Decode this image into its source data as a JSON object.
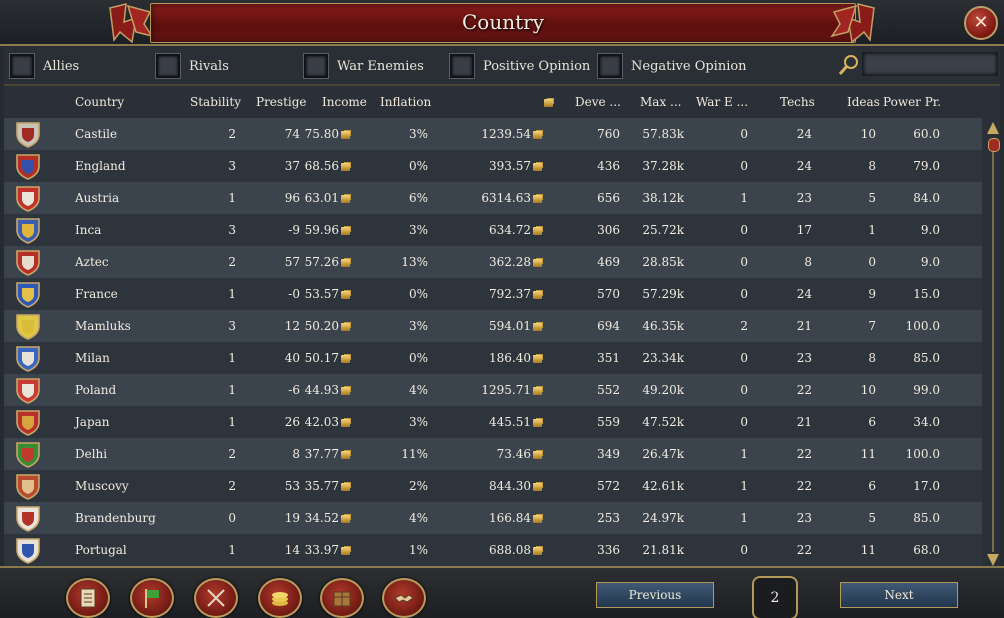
{
  "window": {
    "title": "Country",
    "close_icon": "close-icon"
  },
  "filters": [
    {
      "label": "Allies",
      "checked": false
    },
    {
      "label": "Rivals",
      "checked": false
    },
    {
      "label": "War Enemies",
      "checked": false
    },
    {
      "label": "Positive Opinion",
      "checked": false
    },
    {
      "label": "Negative Opinion",
      "checked": false
    }
  ],
  "search": {
    "value": "",
    "icon": "magnifier-icon"
  },
  "columns": [
    "Country",
    "Stability",
    "Prestige",
    "Income",
    "Inflation",
    "",
    "Deve ...",
    "Max  ...",
    "War E ...",
    "Techs",
    "Ideas",
    "Power Pr."
  ],
  "rows": [
    {
      "country": "Castile",
      "stability": "2",
      "prestige": "74",
      "income": "75.80",
      "inflation": "3%",
      "treasury": "1239.54",
      "development": "760",
      "max": "57.83k",
      "war": "0",
      "techs": "24",
      "ideas": "10",
      "power": "60.0",
      "colors": [
        "#c9c4b8",
        "#a22a24"
      ]
    },
    {
      "country": "England",
      "stability": "3",
      "prestige": "37",
      "income": "68.56",
      "inflation": "0%",
      "treasury": "393.57",
      "development": "436",
      "max": "37.28k",
      "war": "0",
      "techs": "24",
      "ideas": "8",
      "power": "79.0",
      "colors": [
        "#b03026",
        "#3550a8"
      ]
    },
    {
      "country": "Austria",
      "stability": "1",
      "prestige": "96",
      "income": "63.01",
      "inflation": "6%",
      "treasury": "6314.63",
      "development": "656",
      "max": "38.12k",
      "war": "1",
      "techs": "23",
      "ideas": "5",
      "power": "84.0",
      "colors": [
        "#c2322a",
        "#e9e5dc"
      ]
    },
    {
      "country": "Inca",
      "stability": "3",
      "prestige": "-9",
      "income": "59.96",
      "inflation": "3%",
      "treasury": "634.72",
      "development": "306",
      "max": "25.72k",
      "war": "0",
      "techs": "17",
      "ideas": "1",
      "power": "9.0",
      "colors": [
        "#3b5fb0",
        "#e0b53c"
      ]
    },
    {
      "country": "Aztec",
      "stability": "2",
      "prestige": "57",
      "income": "57.26",
      "inflation": "13%",
      "treasury": "362.28",
      "development": "469",
      "max": "28.85k",
      "war": "0",
      "techs": "8",
      "ideas": "0",
      "power": "9.0",
      "colors": [
        "#b62e28",
        "#e6dccb"
      ]
    },
    {
      "country": "France",
      "stability": "1",
      "prestige": "-0",
      "income": "53.57",
      "inflation": "0%",
      "treasury": "792.37",
      "development": "570",
      "max": "57.29k",
      "war": "0",
      "techs": "24",
      "ideas": "9",
      "power": "15.0",
      "colors": [
        "#2d58b8",
        "#e3c04a"
      ]
    },
    {
      "country": "Mamluks",
      "stability": "3",
      "prestige": "12",
      "income": "50.20",
      "inflation": "3%",
      "treasury": "594.01",
      "development": "694",
      "max": "46.35k",
      "war": "2",
      "techs": "21",
      "ideas": "7",
      "power": "100.0",
      "colors": [
        "#e0c744",
        "#d8bc38"
      ]
    },
    {
      "country": "Milan",
      "stability": "1",
      "prestige": "40",
      "income": "50.17",
      "inflation": "0%",
      "treasury": "186.40",
      "development": "351",
      "max": "23.34k",
      "war": "0",
      "techs": "23",
      "ideas": "8",
      "power": "85.0",
      "colors": [
        "#3a66c0",
        "#e8e2d6"
      ]
    },
    {
      "country": "Poland",
      "stability": "1",
      "prestige": "-6",
      "income": "44.93",
      "inflation": "4%",
      "treasury": "1295.71",
      "development": "552",
      "max": "49.20k",
      "war": "0",
      "techs": "22",
      "ideas": "10",
      "power": "99.0",
      "colors": [
        "#c93b34",
        "#ebe6dc"
      ]
    },
    {
      "country": "Japan",
      "stability": "1",
      "prestige": "26",
      "income": "42.03",
      "inflation": "3%",
      "treasury": "445.51",
      "development": "559",
      "max": "47.52k",
      "war": "0",
      "techs": "21",
      "ideas": "6",
      "power": "34.0",
      "colors": [
        "#b8302a",
        "#d9a440"
      ]
    },
    {
      "country": "Delhi",
      "stability": "2",
      "prestige": "8",
      "income": "37.77",
      "inflation": "11%",
      "treasury": "73.46",
      "development": "349",
      "max": "26.47k",
      "war": "1",
      "techs": "22",
      "ideas": "11",
      "power": "100.0",
      "colors": [
        "#3a8c34",
        "#c23a2e"
      ]
    },
    {
      "country": "Muscovy",
      "stability": "2",
      "prestige": "53",
      "income": "35.77",
      "inflation": "2%",
      "treasury": "844.30",
      "development": "572",
      "max": "42.61k",
      "war": "1",
      "techs": "22",
      "ideas": "6",
      "power": "17.0",
      "colors": [
        "#b84a2e",
        "#e2c08c"
      ]
    },
    {
      "country": "Brandenburg",
      "stability": "0",
      "prestige": "19",
      "income": "34.52",
      "inflation": "4%",
      "treasury": "166.84",
      "development": "253",
      "max": "24.97k",
      "war": "1",
      "techs": "23",
      "ideas": "5",
      "power": "85.0",
      "colors": [
        "#e9e5dc",
        "#b3322a"
      ]
    },
    {
      "country": "Portugal",
      "stability": "1",
      "prestige": "14",
      "income": "33.97",
      "inflation": "1%",
      "treasury": "688.08",
      "development": "336",
      "max": "21.81k",
      "war": "0",
      "techs": "22",
      "ideas": "11",
      "power": "68.0",
      "colors": [
        "#e8e3da",
        "#2f55ad"
      ]
    }
  ],
  "bottom_buttons": [
    {
      "icon": "ledger-icon"
    },
    {
      "icon": "flag-icon"
    },
    {
      "icon": "crossed-swords-icon"
    },
    {
      "icon": "coins-icon"
    },
    {
      "icon": "crate-icon"
    },
    {
      "icon": "handshake-icon"
    }
  ],
  "pagination": {
    "previous": "Previous",
    "page": "2",
    "next": "Next"
  },
  "colors": {
    "title_red": "#7a1715",
    "gold_trim": "#b49a5a",
    "row_light": "#3b434d",
    "row_dark": "#2e343c"
  }
}
